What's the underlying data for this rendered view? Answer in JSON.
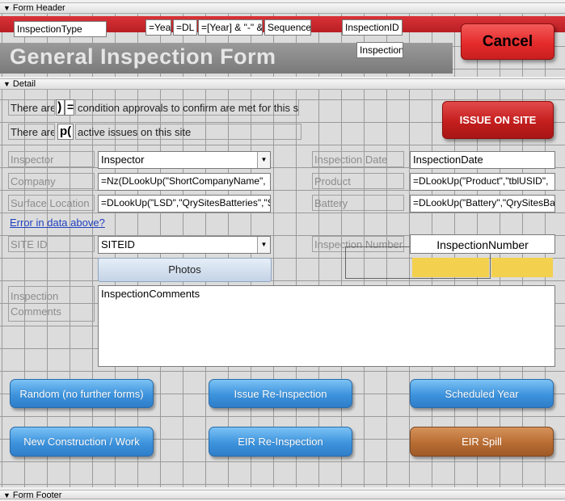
{
  "sections": {
    "header": "Form Header",
    "detail": "Detail",
    "footer": "Form Footer"
  },
  "header": {
    "inspection_type": "InspectionType",
    "expr_year": "=Yea",
    "expr_dl": "=DL",
    "expr_year_concat": "=[Year] & \"-\" &",
    "sequence": "Sequence",
    "inspection_id": "InspectionID",
    "inspection": "Inspection",
    "title": "General Inspection Form",
    "cancel_label": "Cancel",
    "banner_color": "#c8262a"
  },
  "detail": {
    "approvals_prefix": "There are",
    "approvals_value": ")",
    "approvals_eq": "=",
    "approvals_suffix": "condition approvals to confirm are met for this site",
    "issues_prefix": "There are",
    "issues_value": "p(",
    "issues_suffix": "active issues on this site",
    "issue_on_site_label": "ISSUE ON SITE",
    "inspector_label": "Inspector",
    "inspector_value": "Inspector",
    "company_label": "Company",
    "company_value": "=Nz(DLookUp(\"ShortCompanyName\",",
    "surface_label": "Surface Location",
    "surface_value": "=DLookUp(\"LSD\",\"QrySitesBatteries\",\"S",
    "error_link": "Error in data above?",
    "siteid_label": "SITE ID",
    "siteid_value": "SITEID",
    "photos_label": "Photos",
    "inspection_date_label": "Inspection Date",
    "inspection_date_value": "InspectionDate",
    "product_label": "Product",
    "product_value": "=DLookUp(\"Product\",\"tblUSID\",",
    "battery_label": "Battery",
    "battery_value": "=DLookUp(\"Battery\",\"QrySitesBa",
    "inspection_number_label": "Inspection Number",
    "inspection_number_value": "InspectionNumber",
    "comments_label_1": "Inspection",
    "comments_label_2": "Comments",
    "comments_value": "InspectionComments"
  },
  "buttons": {
    "random": "Random (no further forms)",
    "issue_reinspection": "Issue Re-Inspection",
    "scheduled_year": "Scheduled Year",
    "new_construction": "New Construction / Work",
    "eir_reinspection": "EIR Re-Inspection",
    "eir_spill": "EIR Spill"
  },
  "colors": {
    "button_blue": "#3d93dd",
    "button_brown": "#b86d33",
    "cancel_red": "#e8302f",
    "highlight_yellow": "#f3d04d",
    "link_blue": "#1f3fbf"
  }
}
